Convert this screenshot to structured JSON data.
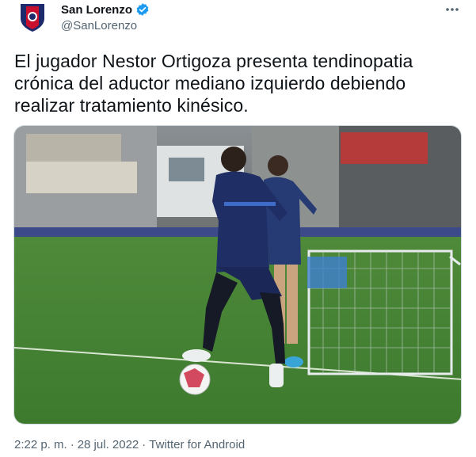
{
  "author": {
    "display_name": "San Lorenzo",
    "handle": "@SanLorenzo",
    "verified": true,
    "avatar_icon": "san-lorenzo-crest",
    "brand_colors": {
      "blue": "#1d2a6b",
      "red": "#c8102e"
    }
  },
  "more_icon": "more-horizontal-icon",
  "tweet": {
    "text_lines": [
      "El jugador Nestor Ortigoza presenta tendinopatia",
      "crónica del aductor mediano izquierdo debiendo",
      "realizar tratamiento kinésico."
    ]
  },
  "media": {
    "description_icon": "photo-players-training"
  },
  "meta": {
    "time": "2:22 p. m.",
    "separator": "·",
    "date": "28 jul. 2022",
    "source": "Twitter for Android"
  },
  "colors": {
    "verified_blue": "#1d9bf0",
    "secondary_text": "#536471"
  }
}
